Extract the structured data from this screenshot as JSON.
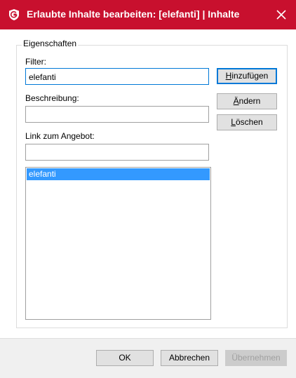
{
  "window": {
    "title": "Erlaubte Inhalte bearbeiten: [elefanti]  | Inhalte",
    "brand_color": "#c8102e",
    "icons": [
      "gdata-shield-icon",
      "close-icon"
    ]
  },
  "group": {
    "legend": "Eigenschaften"
  },
  "fields": {
    "filter_label": "Filter:",
    "filter_value": "elefanti",
    "description_label": "Beschreibung:",
    "description_value": "",
    "link_label": "Link zum Angebot:",
    "link_value": ""
  },
  "list": {
    "items": [
      "elefanti"
    ],
    "selected_color": "#3399ff"
  },
  "side_buttons": {
    "add": {
      "mnemonic": "H",
      "rest": "inzufügen"
    },
    "change": {
      "mnemonic": "Ä",
      "rest": "ndern"
    },
    "delete": {
      "mnemonic": "L",
      "rest": "öschen"
    }
  },
  "footer": {
    "ok_label": "OK",
    "cancel_label": "Abbrechen",
    "apply_label": "Übernehmen"
  }
}
